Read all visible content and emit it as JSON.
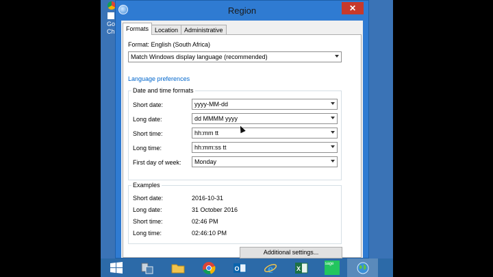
{
  "desktop": {
    "shortcut_label": "Go Ch"
  },
  "window": {
    "title": "Region",
    "close_glyph": "✕"
  },
  "tabs": [
    {
      "label": "Formats",
      "active": true
    },
    {
      "label": "Location",
      "active": false
    },
    {
      "label": "Administrative",
      "active": false
    }
  ],
  "format": {
    "label": "Format: English (South Africa)",
    "value": "Match Windows display language (recommended)"
  },
  "language_link": "Language preferences",
  "date_time": {
    "title": "Date and time formats",
    "rows": [
      {
        "label": "Short date:",
        "value": "yyyy-MM-dd"
      },
      {
        "label": "Long date:",
        "value": "dd MMMM yyyy"
      },
      {
        "label": "Short time:",
        "value": "hh:mm tt"
      },
      {
        "label": "Long time:",
        "value": "hh:mm:ss tt"
      },
      {
        "label": "First day of week:",
        "value": "Monday"
      }
    ]
  },
  "examples": {
    "title": "Examples",
    "rows": [
      {
        "label": "Short date:",
        "value": "2016-10-31"
      },
      {
        "label": "Long date:",
        "value": "31 October 2016"
      },
      {
        "label": "Short time:",
        "value": "02:46 PM"
      },
      {
        "label": "Long time:",
        "value": "02:46:10 PM"
      }
    ]
  },
  "additional_settings": "Additional settings...",
  "taskbar": {
    "sage_label": "sage",
    "items": [
      "windows-start",
      "server-manager",
      "file-explorer",
      "chrome",
      "outlook",
      "internet-explorer",
      "excel",
      "sage",
      "region"
    ]
  },
  "colors": {
    "accent": "#2f7bd2",
    "close": "#c7392b",
    "link": "#0066cc",
    "desktop": "#3a73b6"
  }
}
